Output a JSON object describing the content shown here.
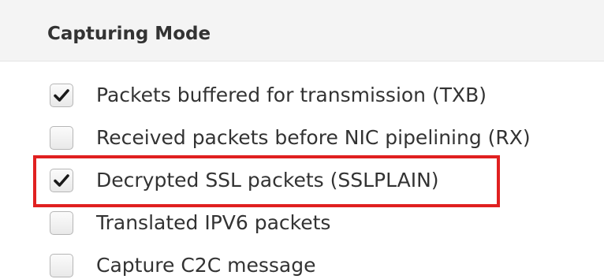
{
  "section": {
    "title": "Capturing Mode"
  },
  "options": [
    {
      "label": "Packets buffered for transmission (TXB)",
      "checked": true
    },
    {
      "label": "Received packets before NIC pipelining (RX)",
      "checked": false
    },
    {
      "label": "Decrypted SSL packets (SSLPLAIN)",
      "checked": true
    },
    {
      "label": "Translated IPV6 packets",
      "checked": false
    },
    {
      "label": "Capture C2C message",
      "checked": false
    }
  ],
  "icons": {
    "check": "checkmark-icon"
  },
  "colors": {
    "highlight": "#e02020",
    "text": "#333333",
    "header_bg": "#f4f4f4"
  }
}
